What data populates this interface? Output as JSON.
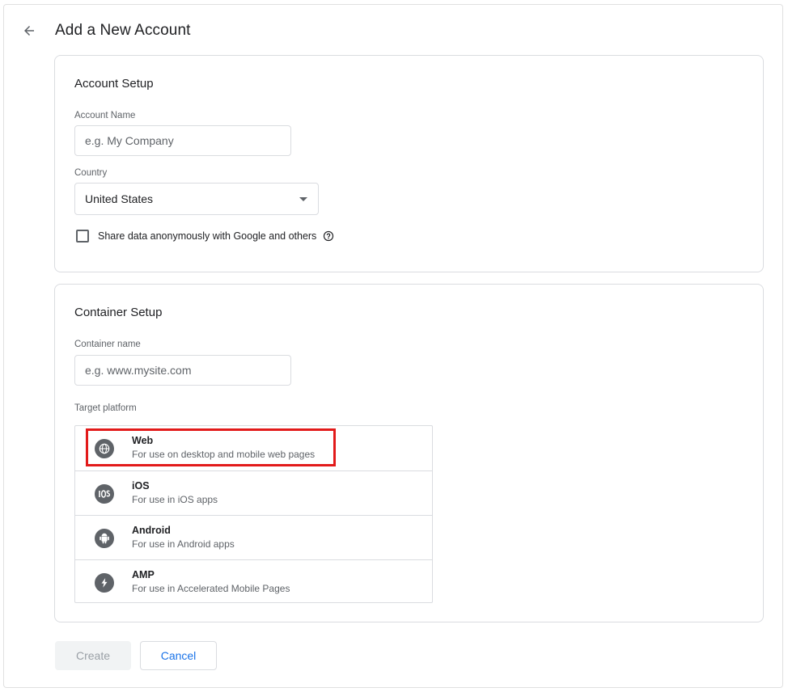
{
  "page": {
    "title": "Add a New Account"
  },
  "account_setup": {
    "title": "Account Setup",
    "account_name_label": "Account Name",
    "account_name_placeholder": "e.g. My Company",
    "account_name_value": "",
    "country_label": "Country",
    "country_value": "United States",
    "share_data_label": "Share data anonymously with Google and others",
    "share_data_checked": false
  },
  "container_setup": {
    "title": "Container Setup",
    "container_name_label": "Container name",
    "container_name_placeholder": "e.g. www.mysite.com",
    "container_name_value": "",
    "target_platform_label": "Target platform",
    "platforms": [
      {
        "name": "Web",
        "description": "For use on desktop and mobile web pages",
        "icon": "globe-icon"
      },
      {
        "name": "iOS",
        "description": "For use in iOS apps",
        "icon": "ios-icon"
      },
      {
        "name": "Android",
        "description": "For use in Android apps",
        "icon": "android-icon"
      },
      {
        "name": "AMP",
        "description": "For use in Accelerated Mobile Pages",
        "icon": "amp-bolt-icon"
      }
    ]
  },
  "actions": {
    "create_label": "Create",
    "cancel_label": "Cancel"
  },
  "colors": {
    "accent": "#1a73e8",
    "highlight": "#e21a1a",
    "border": "#dadce0",
    "icon": "#5f6368"
  }
}
